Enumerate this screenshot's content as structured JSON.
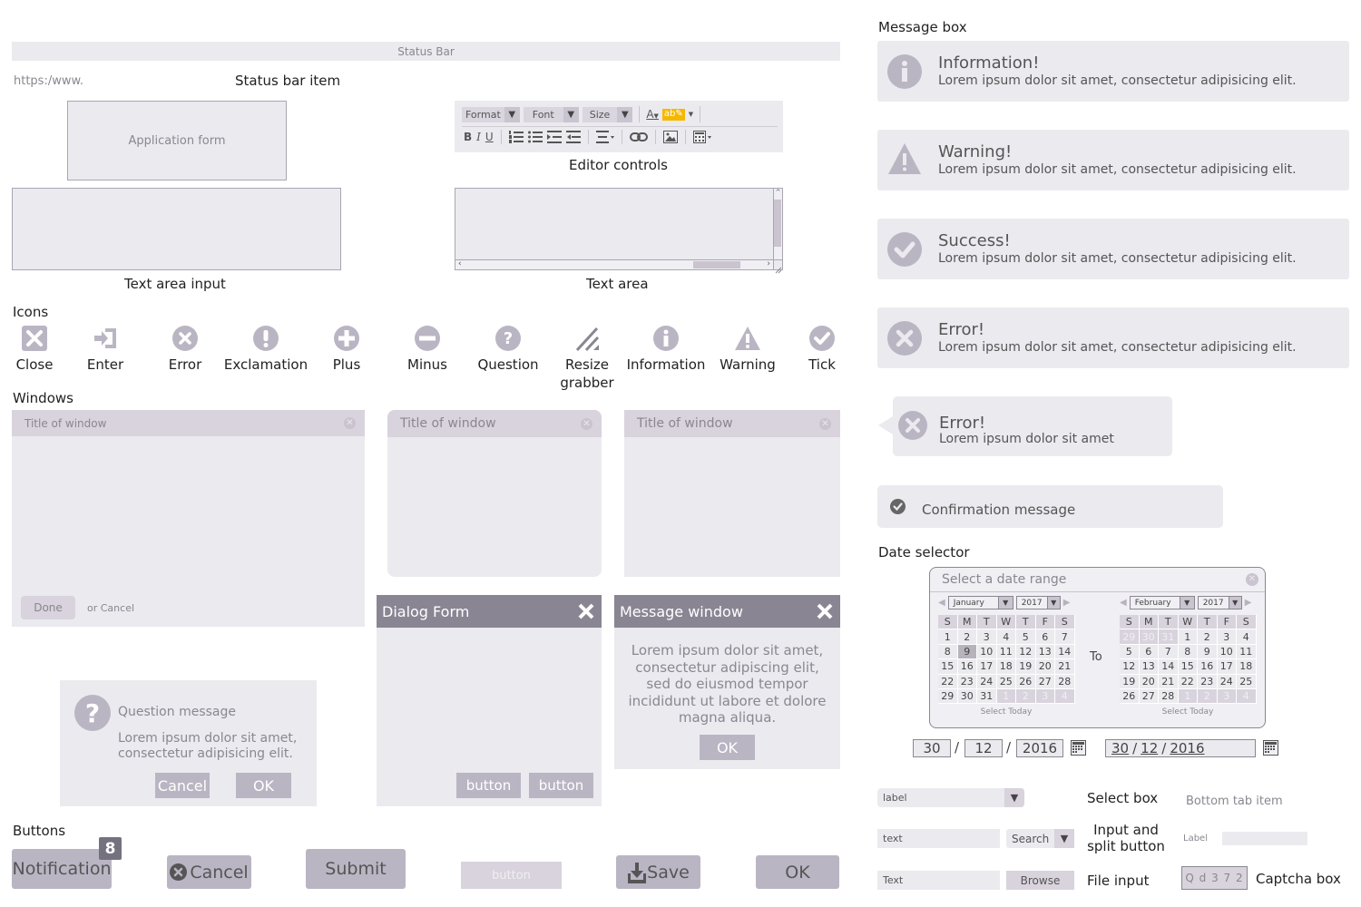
{
  "statusbar": {
    "label": "Status Bar",
    "url": "https:/www.",
    "item_caption": "Status bar item"
  },
  "app_form": {
    "label": "Application form"
  },
  "text_area_input": {
    "caption": "Text area input"
  },
  "editor": {
    "format": "Format",
    "font": "Font",
    "size": "Size",
    "bold": "B",
    "italic": "I",
    "underline": "U",
    "caption": "Editor controls",
    "highlight_color": "#f5b800"
  },
  "text_area": {
    "caption": "Text area"
  },
  "icons": {
    "heading": "Icons",
    "items": [
      {
        "name": "close",
        "label": "Close"
      },
      {
        "name": "enter",
        "label": "Enter"
      },
      {
        "name": "error",
        "label": "Error"
      },
      {
        "name": "exclamation",
        "label": "Exclamation"
      },
      {
        "name": "plus",
        "label": "Plus"
      },
      {
        "name": "minus",
        "label": "Minus"
      },
      {
        "name": "question",
        "label": "Question"
      },
      {
        "name": "resize-grabber",
        "label": "Resize grabber"
      },
      {
        "name": "information",
        "label": "Information"
      },
      {
        "name": "warning",
        "label": "Warning"
      },
      {
        "name": "tick",
        "label": "Tick"
      }
    ]
  },
  "windows": {
    "heading": "Windows",
    "win1": {
      "title": "Title of window",
      "done": "Done",
      "cancel": "or Cancel"
    },
    "win2": {
      "title": "Title of window"
    },
    "win3": {
      "title": "Title of window"
    },
    "question": {
      "title": "Question message",
      "body": "Lorem ipsum dolor sit amet, consectetur adipisicing elit.",
      "cancel": "Cancel",
      "ok": "OK"
    },
    "dialog": {
      "title": "Dialog Form",
      "button1": "button",
      "button2": "button"
    },
    "message": {
      "title": "Message window",
      "body": "Lorem ipsum dolor sit amet, consectetur adipiscing elit, sed do eiusmod tempor incididunt ut labore et dolore magna aliqua.",
      "ok": "OK"
    }
  },
  "buttons": {
    "heading": "Buttons",
    "notification": "Notification",
    "notification_count": "8",
    "cancel": "Cancel",
    "submit": "Submit",
    "disabled": "button",
    "save": "Save",
    "ok": "OK"
  },
  "message_box": {
    "heading": "Message box",
    "items": [
      {
        "title": "Information!",
        "text": "Lorem ipsum dolor sit amet, consectetur adipisicing elit."
      },
      {
        "title": "Warning!",
        "text": "Lorem ipsum dolor sit amet, consectetur adipisicing elit."
      },
      {
        "title": "Success!",
        "text": "Lorem ipsum dolor sit amet, consectetur adipisicing elit."
      },
      {
        "title": "Error!",
        "text": "Lorem ipsum dolor sit amet, consectetur adipisicing elit."
      }
    ],
    "callout": {
      "title": "Error!",
      "text": "Lorem ipsum dolor sit amet"
    },
    "confirmation": "Confirmation message"
  },
  "date_selector": {
    "heading": "Date selector",
    "placeholder": "Select a date range",
    "to": "To",
    "select_today": "Select Today",
    "weekdays": [
      "S",
      "M",
      "T",
      "W",
      "T",
      "F",
      "S"
    ],
    "left": {
      "month": "January",
      "year": "2017",
      "selected": "9",
      "days": [
        "1",
        "2",
        "3",
        "4",
        "5",
        "6",
        "7",
        "8",
        "9",
        "10",
        "11",
        "12",
        "13",
        "14",
        "15",
        "16",
        "17",
        "18",
        "19",
        "20",
        "21",
        "22",
        "23",
        "24",
        "25",
        "26",
        "27",
        "28",
        "29",
        "30",
        "31"
      ],
      "leading": [],
      "trailing": [
        "1",
        "2",
        "3",
        "4"
      ]
    },
    "right": {
      "month": "February",
      "year": "2017",
      "days": [
        "1",
        "2",
        "3",
        "4",
        "5",
        "6",
        "7",
        "8",
        "9",
        "10",
        "11",
        "12",
        "13",
        "14",
        "15",
        "16",
        "17",
        "18",
        "19",
        "20",
        "21",
        "22",
        "23",
        "24",
        "25",
        "26",
        "27",
        "28"
      ],
      "leading": [
        "29",
        "30",
        "31"
      ],
      "trailing": [
        "1",
        "2",
        "3",
        "4"
      ]
    },
    "day": "30",
    "month": "12",
    "year": "2016",
    "combined": {
      "d": "30",
      "m": "12",
      "y": "2016"
    }
  },
  "controls": {
    "select_value": "label",
    "select_caption": "Select box",
    "input_value": "text",
    "split_label": "Search",
    "split_caption": "Input and split button",
    "file_value": "Text",
    "browse": "Browse",
    "file_caption": "File input",
    "bottom_tab": "Bottom tab item",
    "field_label": "Label",
    "captcha": "Q d 3 7 2",
    "captcha_caption": "Captcha box"
  }
}
